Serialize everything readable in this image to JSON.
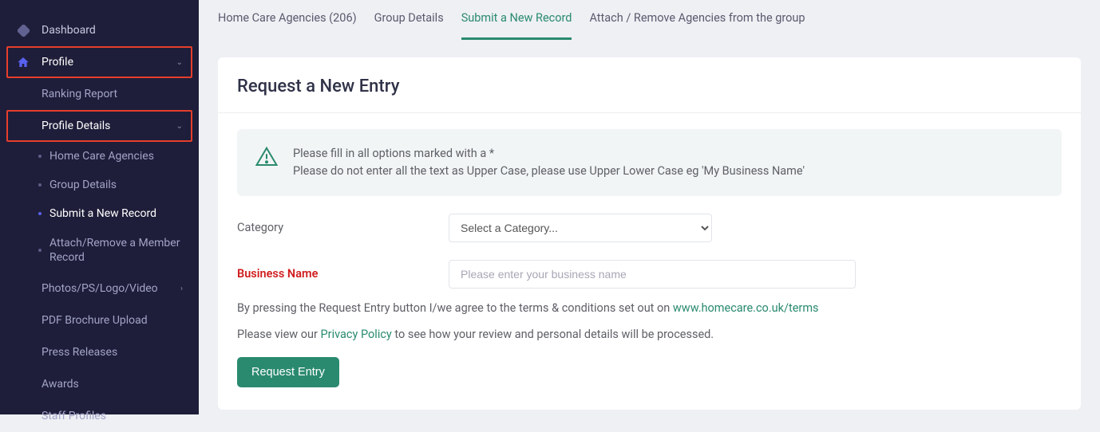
{
  "sidebar": {
    "dashboard": "Dashboard",
    "profile": "Profile",
    "ranking_report": "Ranking Report",
    "profile_details": "Profile Details",
    "sub": {
      "home_care_agencies": "Home Care Agencies",
      "group_details": "Group Details",
      "submit_new_record": "Submit a New Record",
      "attach_remove": "Attach/Remove a Member Record"
    },
    "photos": "Photos/PS/Logo/Video",
    "pdf_brochure": "PDF Brochure Upload",
    "press_releases": "Press Releases",
    "awards": "Awards",
    "staff_profiles": "Staff Profiles"
  },
  "tabs": {
    "home_care": "Home Care Agencies (206)",
    "group_details": "Group Details",
    "submit": "Submit a New Record",
    "attach": "Attach / Remove Agencies from the group"
  },
  "panel": {
    "title": "Request a New Entry",
    "alert_line1": "Please fill in all options marked with a *",
    "alert_line2": "Please do not enter all the text as Upper Case, please use Upper Lower Case eg 'My Business Name'",
    "category_label": "Category",
    "category_placeholder": "Select a Category...",
    "business_name_label": "Business Name",
    "business_name_placeholder": "Please enter your business name",
    "terms_prefix": "By pressing the Request Entry button I/we agree to the terms & conditions set out on ",
    "terms_link": "www.homecare.co.uk/terms",
    "privacy_prefix": "Please view our ",
    "privacy_link": "Privacy Policy",
    "privacy_suffix": " to see how your review and personal details will be processed.",
    "submit_button": "Request Entry"
  }
}
